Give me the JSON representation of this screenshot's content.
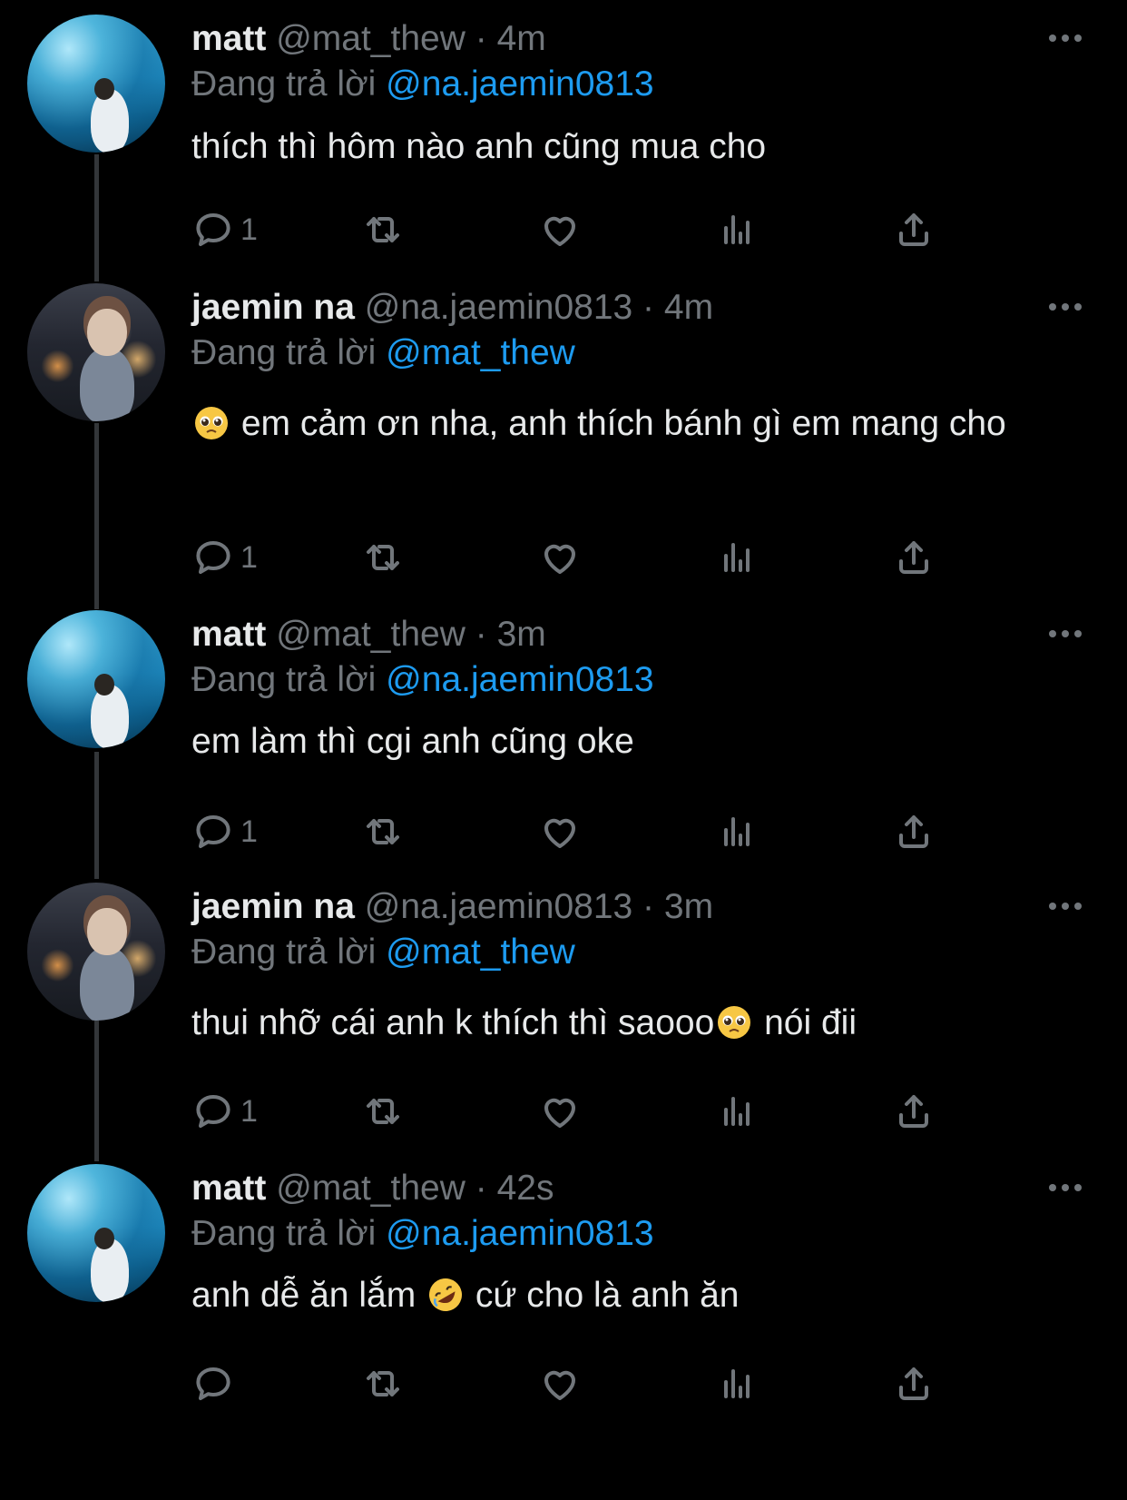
{
  "tweets": [
    {
      "name": "matt",
      "handle": "@mat_thew",
      "sep": "·",
      "time": "4m",
      "replying_label": "Đang trả lời",
      "replying_to": "@na.jaemin0813",
      "text_before": "thích thì hôm nào anh cũng mua cho",
      "emoji": "",
      "text_after": "",
      "reply_count": "1",
      "avatar": "ocean"
    },
    {
      "name": "jaemin na",
      "handle": "@na.jaemin0813",
      "sep": "·",
      "time": "4m",
      "replying_label": "Đang trả lời",
      "replying_to": "@mat_thew",
      "text_before": "",
      "emoji": "pleading-face-icon",
      "text_after": " em cảm ơn nha, anh thích bánh gì em mang cho",
      "reply_count": "1",
      "avatar": "night"
    },
    {
      "name": "matt",
      "handle": "@mat_thew",
      "sep": "·",
      "time": "3m",
      "replying_label": "Đang trả lời",
      "replying_to": "@na.jaemin0813",
      "text_before": "em làm thì cgi anh cũng oke",
      "emoji": "",
      "text_after": "",
      "reply_count": "1",
      "avatar": "ocean"
    },
    {
      "name": "jaemin na",
      "handle": "@na.jaemin0813",
      "sep": "·",
      "time": "3m",
      "replying_label": "Đang trả lời",
      "replying_to": "@mat_thew",
      "text_before": "thui nhỡ cái anh k thích thì saooo",
      "emoji": "pleading-face-icon",
      "text_after": " nói đii",
      "reply_count": "1",
      "avatar": "night"
    },
    {
      "name": "matt",
      "handle": "@mat_thew",
      "sep": "·",
      "time": "42s",
      "replying_label": "Đang trả lời",
      "replying_to": "@na.jaemin0813",
      "text_before": "anh dễ ăn lắm ",
      "emoji": "rofl-face-icon",
      "text_after": " cứ cho là anh ăn",
      "reply_count": "",
      "avatar": "ocean"
    }
  ],
  "icons": {
    "reply": "reply-icon",
    "retweet": "retweet-icon",
    "like": "like-icon",
    "views": "views-icon",
    "share": "share-icon",
    "more": "more-icon"
  },
  "colors": {
    "background": "#000000",
    "text": "#e7e9ea",
    "muted": "#71767b",
    "mention": "#1d9bf0",
    "thread_line": "#333639"
  }
}
